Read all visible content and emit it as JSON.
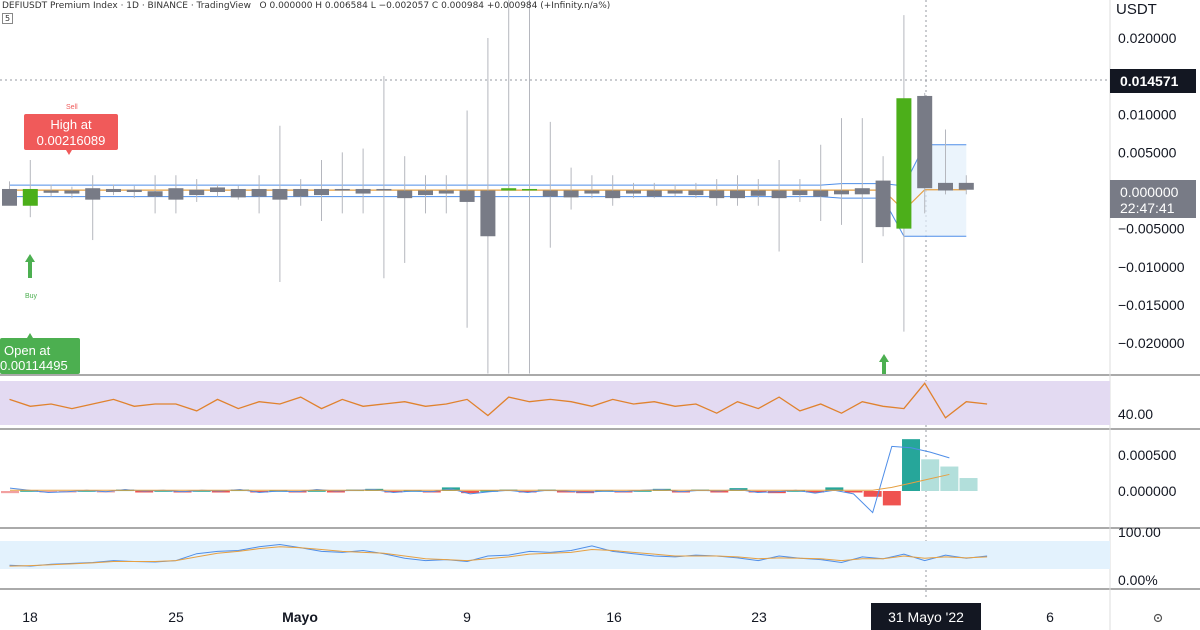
{
  "header": {
    "title": "DEFIUSDT Premium Index · 1D · BINANCE · TradingView",
    "ohlc": "O 0.000000  H 0.006584  L −0.002057  C 0.000984  +0.000984 (+Infinity.n/a%)",
    "interval_badge": "5"
  },
  "price_axis": {
    "unit": "USDT",
    "ticks": [
      "0.020000",
      "0.010000",
      "0.005000",
      "−0.005000",
      "−0.010000",
      "−0.015000",
      "−0.020000"
    ],
    "high_label": "0.014571",
    "last_label": "0.000000",
    "countdown": "22:47:41"
  },
  "annotations": {
    "sell": "Sell",
    "high_title": "High at",
    "high_value": "0.00216089",
    "buy": "Buy",
    "open_title": "Open at",
    "open_value": "0.00114495"
  },
  "rsi_pane": {
    "label": "40.00"
  },
  "macd_pane": {
    "ticks": [
      "0.000500",
      "0.000000"
    ]
  },
  "stoch_pane": {
    "ticks": [
      "100.00",
      "0.00%"
    ]
  },
  "time_axis": {
    "ticks": [
      "18",
      "25",
      "Mayo",
      "9",
      "16",
      "23",
      "6"
    ],
    "crosshair_label": "31 Mayo '22"
  },
  "colors": {
    "up": "#4caf1a",
    "down": "#787b86",
    "sell_box": "#f05a5a",
    "buy_box": "#4caf50",
    "rsi_line": "#e0822e",
    "rsi_band": "#e3daf2",
    "bb_line": "#4f8ee8",
    "ma_line": "#e6a042",
    "hist_teal": "#26a69a",
    "hist_light": "#b2dfdb",
    "hist_red": "#ef5350",
    "stoch_band": "#e3f2fd"
  },
  "chart_data": {
    "type": "candlestick",
    "candles": [
      {
        "o": 0.0002,
        "h": 0.0012,
        "l": -0.0015,
        "c": -0.002
      },
      {
        "o": -0.002,
        "h": 0.004,
        "l": -0.0035,
        "c": 0.0002
      },
      {
        "o": 0.0,
        "h": 0.0008,
        "l": -0.0008,
        "c": -0.0003
      },
      {
        "o": 0.0,
        "h": 0.0005,
        "l": -0.001,
        "c": -0.0004
      },
      {
        "o": 0.0003,
        "h": 0.002,
        "l": -0.0065,
        "c": -0.0012
      },
      {
        "o": 0.0002,
        "h": 0.0008,
        "l": -0.0006,
        "c": -0.0002
      },
      {
        "o": 0.0001,
        "h": 0.0006,
        "l": -0.001,
        "c": -0.0002
      },
      {
        "o": -0.0001,
        "h": 0.002,
        "l": -0.003,
        "c": -0.0008
      },
      {
        "o": 0.0003,
        "h": 0.002,
        "l": -0.003,
        "c": -0.0012
      },
      {
        "o": 0.0001,
        "h": 0.0015,
        "l": -0.0015,
        "c": -0.0006
      },
      {
        "o": 0.0004,
        "h": 0.0008,
        "l": -0.0008,
        "c": -0.0002
      },
      {
        "o": 0.0002,
        "h": 0.0006,
        "l": -0.0012,
        "c": -0.0009
      },
      {
        "o": 0.0002,
        "h": 0.002,
        "l": -0.003,
        "c": -0.0008
      },
      {
        "o": 0.0002,
        "h": 0.0085,
        "l": -0.012,
        "c": -0.0012
      },
      {
        "o": 0.0002,
        "h": 0.0015,
        "l": -0.002,
        "c": -0.0008
      },
      {
        "o": 0.0002,
        "h": 0.004,
        "l": -0.004,
        "c": -0.0006
      },
      {
        "o": 0.0002,
        "h": 0.005,
        "l": -0.003,
        "c": 0.0
      },
      {
        "o": 0.0002,
        "h": 0.0055,
        "l": -0.003,
        "c": -0.0004
      },
      {
        "o": 0.0002,
        "h": 0.015,
        "l": -0.0115,
        "c": 0.0
      },
      {
        "o": 0.0,
        "h": 0.0045,
        "l": -0.0095,
        "c": -0.001
      },
      {
        "o": 0.0,
        "h": 0.002,
        "l": -0.003,
        "c": -0.0006
      },
      {
        "o": 0.0,
        "h": 0.002,
        "l": -0.003,
        "c": -0.0004
      },
      {
        "o": 0.0,
        "h": 0.0105,
        "l": -0.018,
        "c": -0.0015
      },
      {
        "o": 0.0,
        "h": 0.02,
        "l": -0.024,
        "c": -0.006
      },
      {
        "o": 0.0,
        "h": 0.03,
        "l": -0.024,
        "c": 0.0003
      },
      {
        "o": 0.0,
        "h": 0.03,
        "l": -0.024,
        "c": 0.0002
      },
      {
        "o": 0.0,
        "h": 0.009,
        "l": -0.0075,
        "c": -0.0008
      },
      {
        "o": 0.0,
        "h": 0.003,
        "l": -0.0025,
        "c": -0.0009
      },
      {
        "o": 0.0,
        "h": 0.002,
        "l": -0.001,
        "c": -0.0004
      },
      {
        "o": 0.0,
        "h": 0.002,
        "l": -0.002,
        "c": -0.001
      },
      {
        "o": 0.0,
        "h": 0.001,
        "l": -0.001,
        "c": -0.0004
      },
      {
        "o": 0.0,
        "h": 0.001,
        "l": -0.001,
        "c": -0.0008
      },
      {
        "o": 0.0,
        "h": 0.0008,
        "l": -0.0008,
        "c": -0.0004
      },
      {
        "o": 0.0,
        "h": 0.001,
        "l": -0.001,
        "c": -0.0006
      },
      {
        "o": 0.0,
        "h": 0.0015,
        "l": -0.002,
        "c": -0.001
      },
      {
        "o": 0.0,
        "h": 0.002,
        "l": -0.002,
        "c": -0.001
      },
      {
        "o": 0.0,
        "h": 0.0015,
        "l": -0.002,
        "c": -0.0007
      },
      {
        "o": 0.0,
        "h": 0.004,
        "l": -0.008,
        "c": -0.001
      },
      {
        "o": 0.0,
        "h": 0.0015,
        "l": -0.0015,
        "c": -0.0006
      },
      {
        "o": 0.0,
        "h": 0.006,
        "l": -0.004,
        "c": -0.0008
      },
      {
        "o": 0.0,
        "h": 0.0095,
        "l": -0.0045,
        "c": -0.0005
      },
      {
        "o": 0.0003,
        "h": 0.0095,
        "l": -0.0095,
        "c": -0.0005
      },
      {
        "o": 0.0013,
        "h": 0.0045,
        "l": -0.006,
        "c": -0.0048
      },
      {
        "o": -0.005,
        "h": 0.023,
        "l": -0.0185,
        "c": 0.0121
      },
      {
        "o": 0.0124,
        "h": 0.0128,
        "l": -0.003,
        "c": 0.0003
      },
      {
        "o": 0.001,
        "h": 0.008,
        "l": -0.0005,
        "c": 0.0
      },
      {
        "o": 0.001,
        "h": 0.002,
        "l": -0.0005,
        "c": 0.0001
      }
    ],
    "bollinger_upper": 0.006,
    "bollinger_lower": -0.006,
    "y_range": [
      -0.024,
      0.025
    ],
    "rsi": [
      52,
      49,
      50,
      48,
      50,
      52,
      49,
      50,
      50,
      47,
      52,
      48,
      51,
      50,
      53,
      48,
      52,
      49,
      50,
      51,
      49,
      50,
      52,
      45,
      53,
      51,
      52,
      51,
      49,
      52,
      50,
      51,
      49,
      50,
      46,
      51,
      48,
      53,
      47,
      50,
      46,
      51,
      49,
      48,
      59,
      44,
      51,
      50
    ],
    "macd_hist": [
      -3e-05,
      1e-05,
      -1e-05,
      -2e-05,
      1e-05,
      -1e-05,
      2e-05,
      -2e-05,
      1e-05,
      -1e-05,
      1e-05,
      -1e-05,
      2e-05,
      -2e-05,
      1e-05,
      -2e-05,
      1e-05,
      -1e-05,
      2e-05,
      3e-05,
      -2e-05,
      1e-05,
      -1e-05,
      5e-05,
      -3e-05,
      1e-05,
      2e-05,
      -2e-05,
      2e-05,
      -1e-05,
      -3e-05,
      1e-05,
      -2e-05,
      1e-05,
      3e-05,
      -2e-05,
      2e-05,
      -1e-05,
      4e-05,
      -2e-05,
      -3e-05,
      1e-05,
      -1e-05,
      5e-05,
      -1e-05,
      -8e-05,
      -0.0002,
      0.00072,
      0.00044,
      0.00034,
      0.00018
    ],
    "macd_line": [
      4e-05,
      1e-05,
      -2e-05,
      -1e-05,
      1e-05,
      -1e-05,
      2e-05,
      0.0,
      1e-05,
      -1e-05,
      1e-05,
      0.0,
      2e-05,
      -2e-05,
      0.0,
      -1e-05,
      2e-05,
      0.0,
      1e-05,
      2e-05,
      -2e-05,
      0.0,
      -1e-05,
      3e-05,
      -4e-05,
      -1e-05,
      1e-05,
      -2e-05,
      1e-05,
      0.0,
      -2e-05,
      0.0,
      -1e-05,
      1e-05,
      2e-05,
      -1e-05,
      1e-05,
      0.0,
      2e-05,
      -2e-05,
      -1e-05,
      1e-05,
      -3e-05,
      1e-05,
      -4e-05,
      -0.0003,
      0.00062,
      0.0006,
      0.00054,
      0.00046
    ],
    "stoch_k": [
      30,
      28,
      32,
      34,
      36,
      40,
      38,
      37,
      40,
      55,
      60,
      62,
      70,
      75,
      68,
      60,
      58,
      62,
      55,
      45,
      40,
      42,
      38,
      50,
      52,
      60,
      58,
      62,
      72,
      60,
      55,
      50,
      48,
      52,
      50,
      46,
      40,
      50,
      45,
      42,
      36,
      48,
      44,
      54,
      40,
      52,
      45,
      50
    ],
    "stoch_d": [
      28,
      29,
      31,
      33,
      35,
      38,
      38,
      38,
      40,
      48,
      56,
      60,
      66,
      70,
      68,
      64,
      60,
      58,
      56,
      50,
      44,
      42,
      40,
      44,
      48,
      54,
      56,
      58,
      64,
      62,
      58,
      54,
      50,
      50,
      50,
      48,
      44,
      46,
      45,
      44,
      40,
      44,
      44,
      50,
      45,
      48,
      46,
      48
    ]
  }
}
